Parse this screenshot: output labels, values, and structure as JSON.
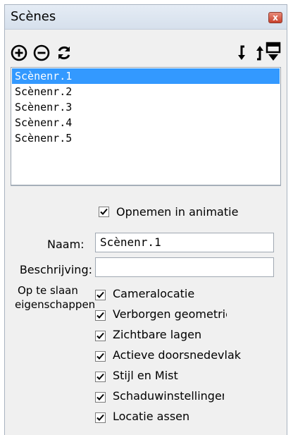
{
  "window": {
    "title": "Scènes",
    "close_label": "x"
  },
  "toolbar": {
    "icons": [
      "add-scene-icon",
      "remove-scene-icon",
      "update-scene-icon",
      "move-scene-down-icon",
      "move-scene-up-icon",
      "scene-details-icon"
    ]
  },
  "scenes": [
    {
      "name": "Scènenr.1",
      "selected": true
    },
    {
      "name": "Scènenr.2",
      "selected": false
    },
    {
      "name": "Scènenr.3",
      "selected": false
    },
    {
      "name": "Scènenr.4",
      "selected": false
    },
    {
      "name": "Scènenr.5",
      "selected": false
    }
  ],
  "details": {
    "include_animation_label": "Opnemen in animatie",
    "include_animation_checked": true,
    "name_label": "Naam:",
    "name_value": "Scènenr.1",
    "description_label": "Beschrijving:",
    "description_value": "",
    "save_properties_label_1": "Op te slaan",
    "save_properties_label_2": "eigenschappen",
    "properties": [
      {
        "label": "Cameralocatie",
        "checked": true
      },
      {
        "label": "Verborgen geometrie",
        "checked": true
      },
      {
        "label": "Zichtbare lagen",
        "checked": true
      },
      {
        "label": "Actieve doorsnedevlak",
        "checked": true
      },
      {
        "label": "Stijl en Mist",
        "checked": true
      },
      {
        "label": "Schaduwinstellingen",
        "checked": true
      },
      {
        "label": "Locatie assen",
        "checked": true
      }
    ]
  },
  "colors": {
    "selection": "#3399ff",
    "panel_bg": "#f0f0f0",
    "close_button": "#c8412c"
  }
}
